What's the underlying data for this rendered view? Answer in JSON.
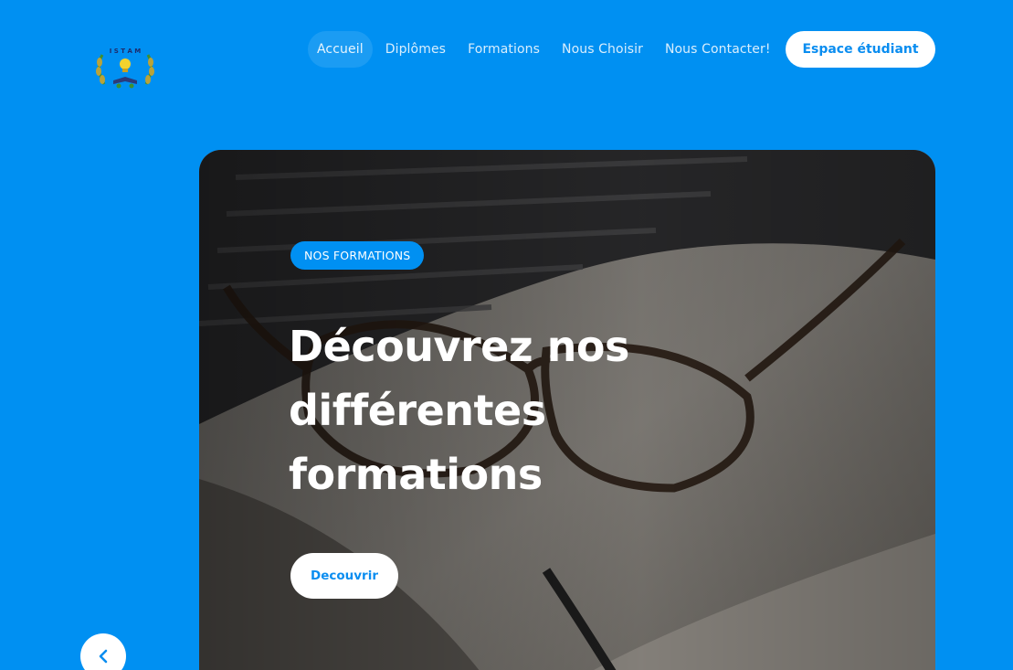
{
  "header": {
    "logo_icon": "istam-logo-icon",
    "nav": [
      {
        "label": "Accueil",
        "active": true
      },
      {
        "label": "Diplômes",
        "active": false
      },
      {
        "label": "Formations",
        "active": false
      },
      {
        "label": "Nous Choisir",
        "active": false
      },
      {
        "label": "Nous Contacter!",
        "active": false
      }
    ],
    "student_space_label": "Espace étudiant"
  },
  "hero": {
    "badge": "NOS FORMATIONS",
    "title": "Découvrez nos différentes formations",
    "cta_label": "Decouvrir",
    "image_icon": "laptop-glasses-photo"
  },
  "carousel": {
    "prev_icon": "chevron-left-icon"
  },
  "colors": {
    "background": "#0090f2",
    "accent": "#0a8df0",
    "badge": "#0090f2"
  }
}
